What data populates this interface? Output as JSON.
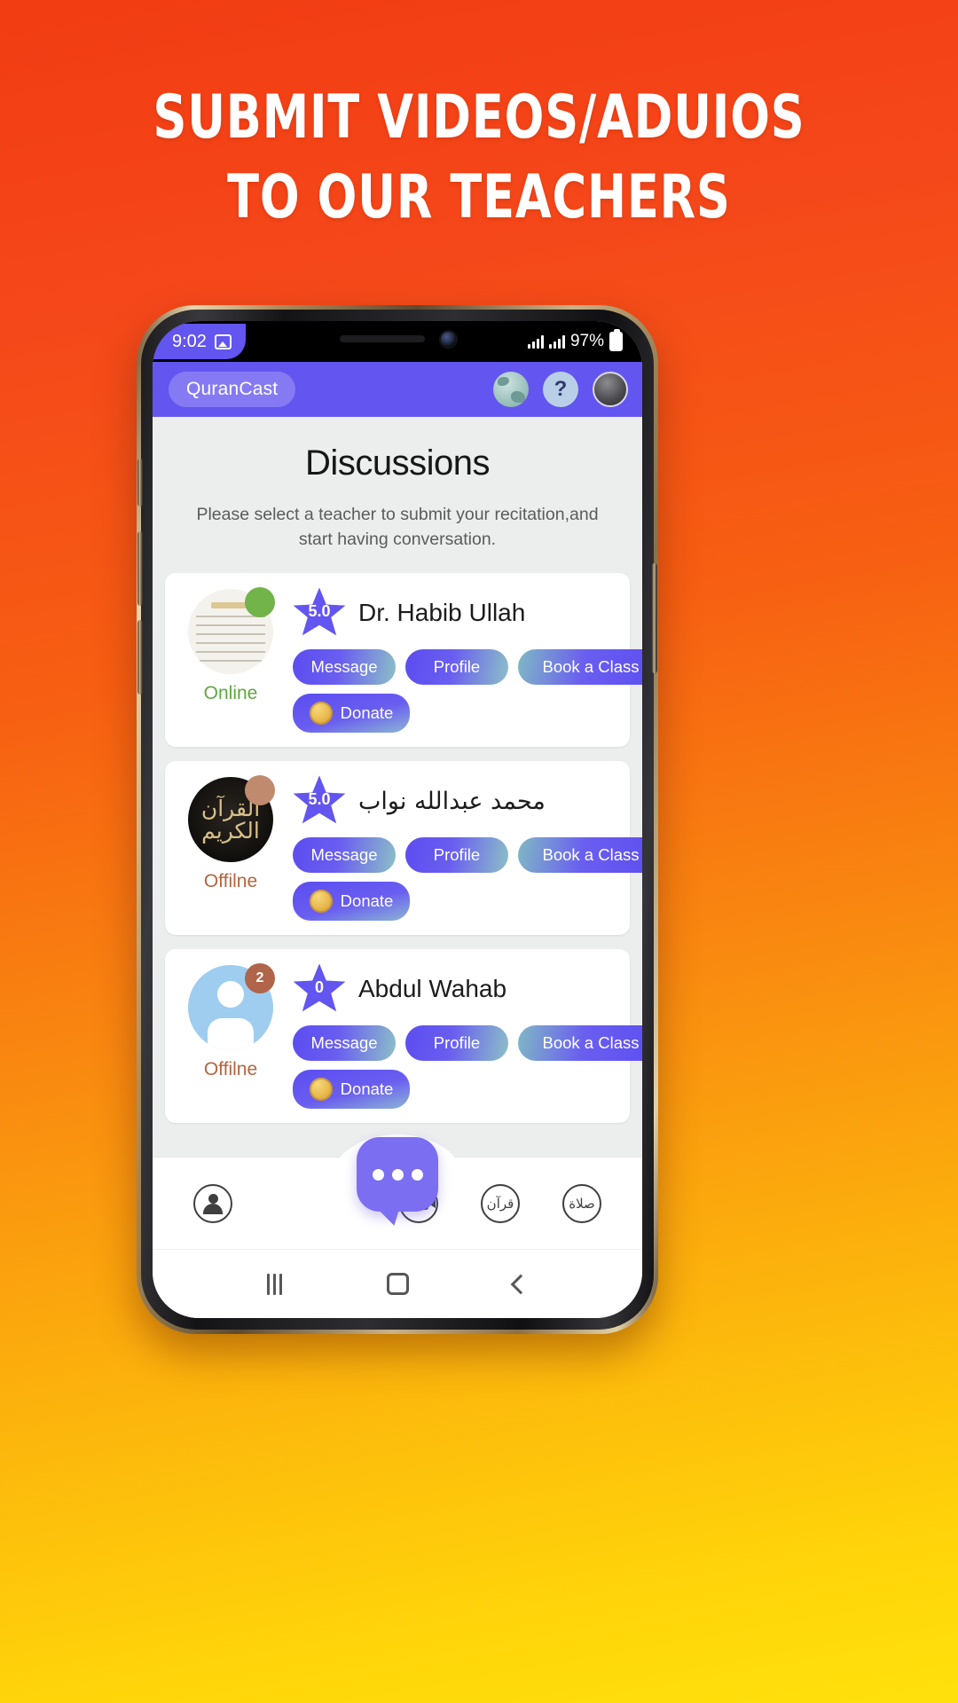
{
  "promo": {
    "line1": "SUBMIT VIDEOS/ADUIOS",
    "line2": "TO OUR TEACHERS"
  },
  "statusbar": {
    "time": "9:02",
    "image_icon": "image-icon",
    "signal_icon": "signal-bars-icon",
    "battery_percent": "97%",
    "battery_icon": "battery-icon"
  },
  "appbar": {
    "brand": "QuranCast",
    "icons": [
      "globe-icon",
      "help-icon",
      "profile-avatar"
    ],
    "help_glyph": "?",
    "background": "#6355f0"
  },
  "page": {
    "title": "Discussions",
    "subtitle": "Please select a teacher to submit your recitation,and start having conversation."
  },
  "labels": {
    "message": "Message",
    "profile": "Profile",
    "book": "Book a Class",
    "donate": "Donate"
  },
  "teachers": [
    {
      "name": "Dr. Habib Ullah",
      "rating": "5.0",
      "status": "Online",
      "badge": "",
      "avatar_kind": "quran-page",
      "avatar_text": ""
    },
    {
      "name": "محمد عبدالله نواب",
      "rating": "5.0",
      "status": "Offilne",
      "badge": "",
      "avatar_kind": "dark-calligraphy",
      "avatar_text": "القرآن الكريم"
    },
    {
      "name": "Abdul Wahab",
      "rating": "0",
      "status": "Offilne",
      "badge": "2",
      "avatar_kind": "person",
      "avatar_text": ""
    }
  ],
  "bottomnav": {
    "items": [
      "account-icon",
      "chat-fab-icon",
      "video-icon",
      "quran-icon",
      "prayer-icon"
    ],
    "quran_glyph": "قرآن",
    "prayer_glyph": "صلاة"
  },
  "androidnav": {
    "recent": "recent-apps-button",
    "home": "home-button",
    "back": "back-button"
  },
  "colors": {
    "accent": "#6355f0",
    "online": "#5fa83d",
    "offline": "#b5643e",
    "bg_start": "#f23c12",
    "bg_end": "#ffe00c"
  }
}
